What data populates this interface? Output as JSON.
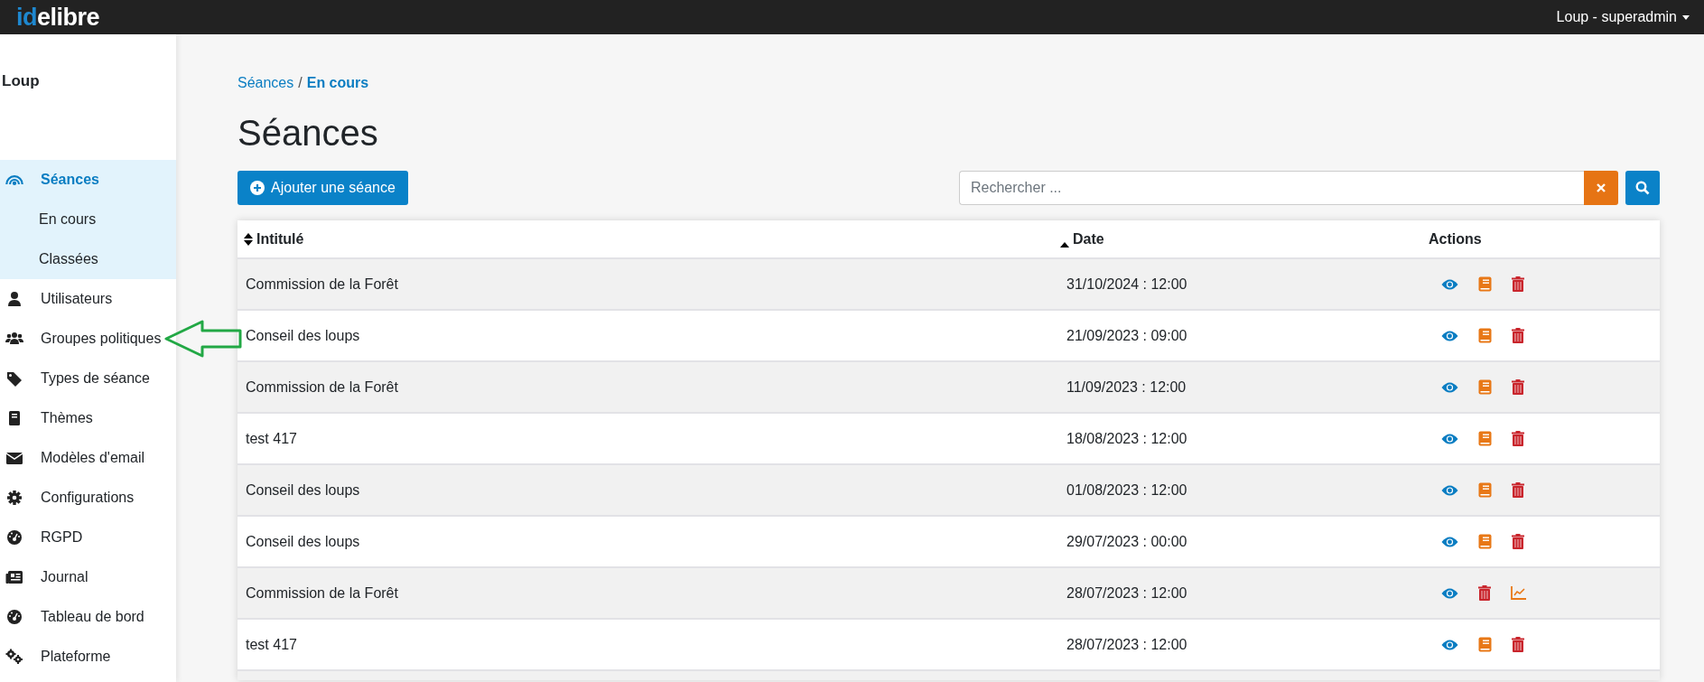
{
  "topbar": {
    "logo": [
      "id",
      "elibre"
    ],
    "user_menu": "Loup - superadmin"
  },
  "sidebar": {
    "title": "Loup",
    "items": [
      {
        "label": "Séances",
        "selected": true,
        "expanded": true,
        "children": [
          {
            "label": "En cours"
          },
          {
            "label": "Classées"
          }
        ]
      },
      {
        "label": "Utilisateurs",
        "selected": false
      },
      {
        "label": "Groupes politiques",
        "selected": false
      },
      {
        "label": "Types de séance",
        "selected": false
      },
      {
        "label": "Thèmes",
        "selected": false
      },
      {
        "label": "Modèles d'email",
        "selected": false
      },
      {
        "label": "Configurations",
        "selected": false
      },
      {
        "label": "RGPD",
        "selected": false
      },
      {
        "label": "Journal",
        "selected": false
      },
      {
        "label": "Tableau de bord",
        "selected": false
      },
      {
        "label": "Plateforme",
        "selected": false
      }
    ]
  },
  "breadcrumb": {
    "separator": "/",
    "links": [
      "Séances",
      "En cours"
    ]
  },
  "page_title": "Séances",
  "add_button": "Ajouter une séance",
  "search": {
    "placeholder": "Rechercher ..."
  },
  "table": {
    "columns": [
      {
        "label": "Intitulé",
        "kind": "sortable"
      },
      {
        "label": "Date",
        "kind": "sorted_ascending"
      },
      {
        "label": "Actions",
        "kind": "plain"
      }
    ],
    "rows": [
      {
        "title": "Commission de la Forêt",
        "date": "31/10/2024 : 12:00",
        "actions": [
          {
            "kind": "view"
          },
          {
            "kind": "notes"
          },
          {
            "kind": "delete"
          }
        ]
      },
      {
        "title": "Conseil des loups",
        "date": "21/09/2023 : 09:00",
        "actions": [
          {
            "kind": "view"
          },
          {
            "kind": "notes"
          },
          {
            "kind": "delete"
          }
        ]
      },
      {
        "title": "Commission de la Forêt",
        "date": "11/09/2023 : 12:00",
        "actions": [
          {
            "kind": "view"
          },
          {
            "kind": "notes"
          },
          {
            "kind": "delete"
          }
        ]
      },
      {
        "title": "test 417",
        "date": "18/08/2023 : 12:00",
        "actions": [
          {
            "kind": "view"
          },
          {
            "kind": "notes"
          },
          {
            "kind": "delete"
          }
        ]
      },
      {
        "title": "Conseil des loups",
        "date": "01/08/2023 : 12:00",
        "actions": [
          {
            "kind": "view"
          },
          {
            "kind": "notes"
          },
          {
            "kind": "delete"
          }
        ]
      },
      {
        "title": "Conseil des loups",
        "date": "29/07/2023 : 00:00",
        "actions": [
          {
            "kind": "view"
          },
          {
            "kind": "notes"
          },
          {
            "kind": "delete"
          }
        ]
      },
      {
        "title": "Commission de la Forêt",
        "date": "28/07/2023 : 12:00",
        "actions": [
          {
            "kind": "view"
          },
          {
            "kind": "delete"
          },
          {
            "kind": "stats"
          }
        ]
      },
      {
        "title": "test 417",
        "date": "28/07/2023 : 12:00",
        "actions": [
          {
            "kind": "view"
          },
          {
            "kind": "notes"
          },
          {
            "kind": "delete"
          }
        ]
      }
    ]
  },
  "annotation": {
    "kind": "arrow"
  }
}
